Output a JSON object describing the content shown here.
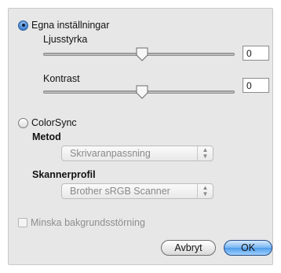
{
  "own_settings": {
    "label": "Egna inställningar",
    "brightness": {
      "label": "Ljusstyrka",
      "value": "0",
      "level_percent": 50
    },
    "contrast": {
      "label": "Kontrast",
      "value": "0",
      "level_percent": 50
    }
  },
  "colorsync": {
    "label": "ColorSync",
    "method": {
      "label": "Metod",
      "selected": "Skrivaranpassning"
    },
    "scanner_profile": {
      "label": "Skannerprofil",
      "selected": "Brother sRGB Scanner"
    }
  },
  "noise_reduction": {
    "label": "Minska bakgrundsstörning",
    "checked": false
  },
  "buttons": {
    "cancel": "Avbryt",
    "ok": "OK"
  },
  "colors": {
    "accent": "#4f9cea",
    "panel": "#e7e7e7"
  }
}
